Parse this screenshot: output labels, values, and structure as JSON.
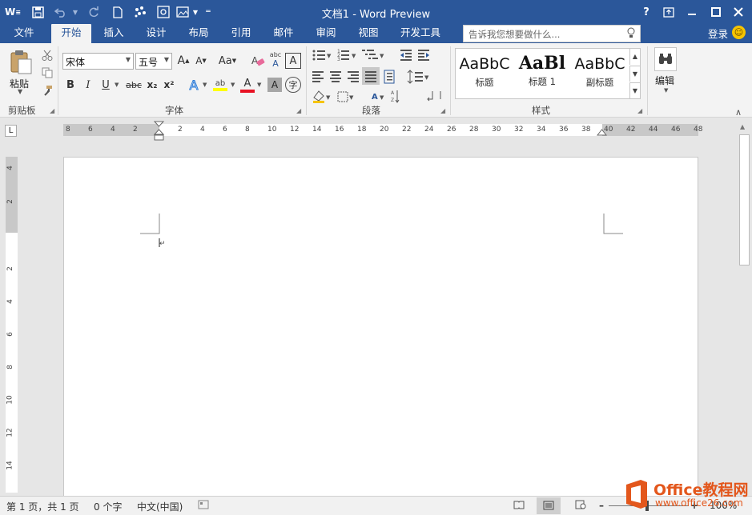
{
  "titlebar": {
    "app_icon": "W",
    "title": "文档1 - Word Preview",
    "help": "?",
    "qa_icons": [
      "save-icon",
      "undo-icon",
      "redo-icon",
      "new-doc-icon",
      "touch-mode-icon",
      "screenshot-icon",
      "customize-icon"
    ]
  },
  "tabs": [
    "文件",
    "开始",
    "插入",
    "设计",
    "布局",
    "引用",
    "邮件",
    "审阅",
    "视图",
    "开发工具"
  ],
  "active_tab": "开始",
  "tellme": {
    "placeholder": "告诉我您想要做什么..."
  },
  "account": {
    "signin": "登录",
    "smiley": "☺"
  },
  "ribbon": {
    "clipboard": {
      "label": "剪贴板",
      "paste": "粘贴"
    },
    "font": {
      "label": "字体",
      "font_name": "宋体",
      "font_size": "五号",
      "grow": "A",
      "shrink": "A",
      "case": "Aa",
      "bold": "B",
      "italic": "I",
      "underline": "U",
      "strike": "abc",
      "sub": "x₂",
      "sup": "x²",
      "effects": "A",
      "highlight": "ab",
      "fontcolor": "A",
      "shade": "A",
      "phonetic": "字",
      "clear": "A",
      "pinyin": "abc",
      "border": "A"
    },
    "paragraph": {
      "label": "段落"
    },
    "styles": {
      "label": "样式",
      "items": [
        {
          "preview": "AaBbC",
          "name": "标题"
        },
        {
          "preview": "AaBl",
          "name": "标题 1"
        },
        {
          "preview": "AaBbC",
          "name": "副标题"
        }
      ]
    },
    "editing": {
      "label": "编辑"
    }
  },
  "ruler": {
    "corner": "L",
    "h_ticks": [
      "8",
      "6",
      "4",
      "2",
      "2",
      "4",
      "6",
      "8",
      "10",
      "12",
      "14",
      "16",
      "18",
      "20",
      "22",
      "24",
      "26",
      "28",
      "30",
      "32",
      "34",
      "36",
      "38",
      "40",
      "42",
      "44",
      "46",
      "48"
    ],
    "v_ticks_upper": [
      "4",
      "2"
    ],
    "v_ticks_lower": [
      "2",
      "4",
      "6",
      "8",
      "10",
      "12",
      "14"
    ]
  },
  "statusbar": {
    "page": "第 1 页，共 1 页",
    "words": "0 个字",
    "lang": "中文(中国)",
    "zoom": "100%"
  },
  "watermark": {
    "brand": "Office教程网",
    "url": "www.office26.com"
  },
  "colors": {
    "accent": "#2b579a",
    "highlight": "#ffff00",
    "fontcolor": "#e81123",
    "logo": "#e3571c"
  }
}
